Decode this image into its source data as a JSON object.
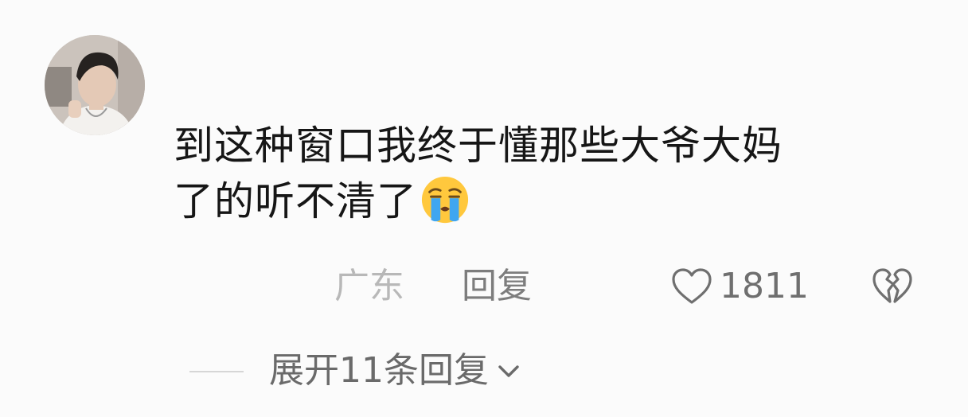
{
  "comment": {
    "lines": [
      "到这种窗口我终于懂那些大爷大妈",
      "了的听不清了"
    ],
    "emoji": "crying-face-emoji",
    "location": "广东",
    "reply_label": "回复",
    "like_count": "1811",
    "expand_label": "展开11条回复"
  },
  "colors": {
    "background": "#fbfbfb",
    "text": "#161616",
    "muted": "#b8b8b8",
    "secondary": "#7d7d7d"
  },
  "icons": {
    "like": "heart-outline-icon",
    "dislike": "broken-heart-icon",
    "expand": "chevron-down-icon"
  }
}
